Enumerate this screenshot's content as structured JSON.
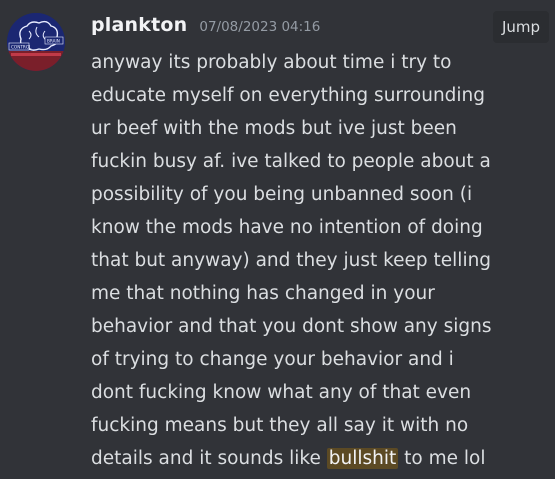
{
  "message": {
    "author": "plankton",
    "timestamp": "07/08/2023 04:16",
    "jump_label": "Jump",
    "avatar_text_left": "CONTROL",
    "avatar_text_right": "BRAIN",
    "lines": [
      "anyway its probably about time i try to",
      "educate myself on everything surrounding",
      "ur beef with the mods but ive just been",
      "fuckin busy af. ive talked to people about a",
      "possibility of you being unbanned soon (i",
      "know the mods have no intention of doing",
      "that but anyway) and they just keep telling",
      "me that nothing has changed in your",
      "behavior and that you dont show any signs",
      "of trying to change your behavior and i",
      "dont fucking know what any of that even",
      "fucking means but they all say it with no"
    ],
    "last_line": {
      "before": "details and it sounds like ",
      "highlight": "bullshit",
      "after": " to me lol"
    }
  },
  "colors": {
    "background": "#313338",
    "text": "#dbdee1",
    "username": "#f2f3f5",
    "timestamp": "#949ba4",
    "jump_bg": "#2b2d31",
    "highlight_bg": "#5c4a24"
  }
}
